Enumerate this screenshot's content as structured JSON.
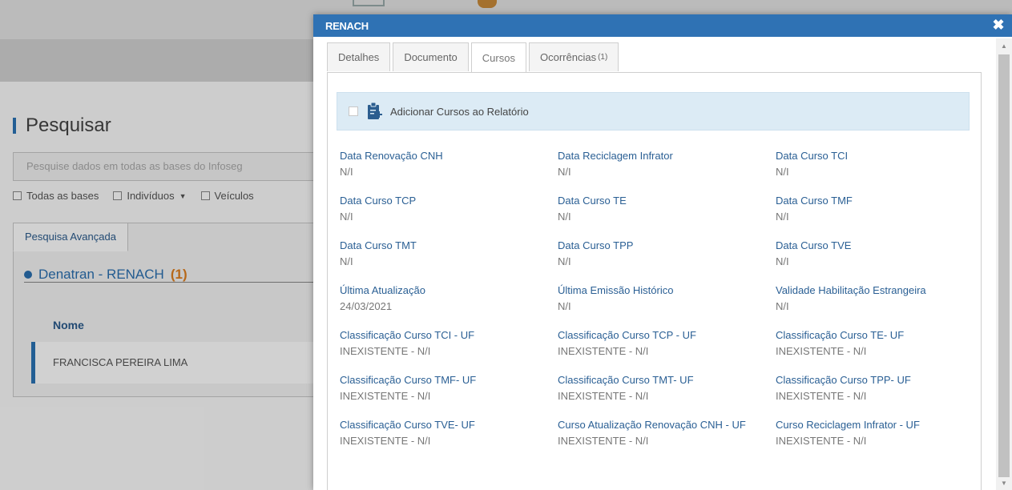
{
  "background": {
    "title": "Pesquisar",
    "search_placeholder": "Pesquise dados em todas as bases do Infoseg",
    "filters": [
      {
        "label": "Todas as bases"
      },
      {
        "label": "Indivíduos"
      },
      {
        "label": "Veículos"
      }
    ],
    "tab_label": "Pesquisa Avançada",
    "section": {
      "label": "Denatran - RENACH",
      "count": "(1)"
    },
    "table_header": "Nome",
    "row_value": "FRANCISCA PEREIRA LIMA"
  },
  "modal": {
    "title": "RENACH",
    "tabs": [
      {
        "label": "Detalhes"
      },
      {
        "label": "Documento"
      },
      {
        "label": "Cursos"
      },
      {
        "label": "Ocorrências",
        "badge": "(1)"
      }
    ],
    "active_tab": "Cursos",
    "add_label": "Adicionar Cursos ao Relatório",
    "fields": [
      {
        "label": "Data Renovação CNH",
        "value": "N/I"
      },
      {
        "label": "Data Reciclagem Infrator",
        "value": "N/I"
      },
      {
        "label": "Data Curso TCI",
        "value": "N/I"
      },
      {
        "label": "Data Curso TCP",
        "value": "N/I"
      },
      {
        "label": "Data Curso TE",
        "value": "N/I"
      },
      {
        "label": "Data Curso TMF",
        "value": "N/I"
      },
      {
        "label": "Data Curso TMT",
        "value": "N/I"
      },
      {
        "label": "Data Curso TPP",
        "value": "N/I"
      },
      {
        "label": "Data Curso TVE",
        "value": "N/I"
      },
      {
        "label": "Última Atualização",
        "value": "24/03/2021"
      },
      {
        "label": "Última Emissão Histórico",
        "value": "N/I"
      },
      {
        "label": "Validade Habilitação Estrangeira",
        "value": "N/I"
      },
      {
        "label": "Classificação Curso TCI - UF",
        "value": "INEXISTENTE - N/I"
      },
      {
        "label": "Classificação Curso TCP - UF",
        "value": "INEXISTENTE - N/I"
      },
      {
        "label": "Classificação Curso TE- UF",
        "value": "INEXISTENTE - N/I"
      },
      {
        "label": "Classificação Curso TMF- UF",
        "value": "INEXISTENTE - N/I"
      },
      {
        "label": "Classificação Curso TMT- UF",
        "value": "INEXISTENTE - N/I"
      },
      {
        "label": "Classificação Curso TPP- UF",
        "value": "INEXISTENTE - N/I"
      },
      {
        "label": "Classificação Curso TVE- UF",
        "value": "INEXISTENTE - N/I"
      },
      {
        "label": "Curso Atualização Renovação CNH - UF",
        "value": "INEXISTENTE - N/I"
      },
      {
        "label": "Curso Reciclagem Infrator - UF",
        "value": "INEXISTENTE - N/I"
      }
    ]
  },
  "colors": {
    "header": "#2f72b4",
    "label": "#2a5f94",
    "accent_orange": "#e07f1f",
    "add_bar": "#dcebf5"
  },
  "icons": {
    "close": "close-icon",
    "add_to_report": "clipboard-add-icon",
    "section_toggle": "circle-icon"
  }
}
